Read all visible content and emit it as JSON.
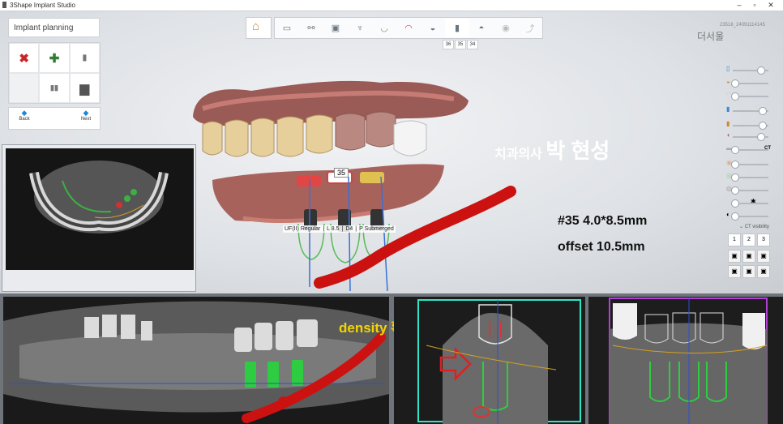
{
  "window": {
    "title": "3Shape Implant Studio"
  },
  "left_panel": {
    "title": "Implant planning",
    "tools": [
      {
        "icon": "delete-x-icon",
        "glyph": "✖",
        "color": "#c62828"
      },
      {
        "icon": "add-plus-icon",
        "glyph": "✚",
        "color": "#2e7d32"
      },
      {
        "icon": "implant-icon",
        "glyph": "▮",
        "color": "#777777"
      },
      {
        "icon": "empty",
        "glyph": "",
        "color": "#ffffff"
      },
      {
        "icon": "implant-pair-icon",
        "glyph": "▮▮",
        "color": "#777777"
      },
      {
        "icon": "abutment-icon",
        "glyph": "▆",
        "color": "#555555"
      }
    ],
    "back_label": "Back",
    "next_label": "Next"
  },
  "tooth_labels": [
    "36",
    "35",
    "34"
  ],
  "patient": {
    "case_id": "23518_24091114145",
    "name": "더서울"
  },
  "right_panel": {
    "ct_label": "CT",
    "ct_visibility": "CT visibility",
    "ct_buttons": [
      "1",
      "2",
      "3"
    ]
  },
  "implant_labels": [
    "UF(II) Regular",
    "L 8.5",
    "D4",
    "P Submerged"
  ],
  "implant_number": "35",
  "annotations": {
    "dentist": "치과의사",
    "dentist_name": "박 현성",
    "spec": "#35 4.0*8.5mm",
    "offset": "offset 10.5mm",
    "density": "density 확인"
  },
  "colors": {
    "nerve": "#cc1111",
    "density_text": "#f4d400",
    "accent": "#1e88d8"
  }
}
